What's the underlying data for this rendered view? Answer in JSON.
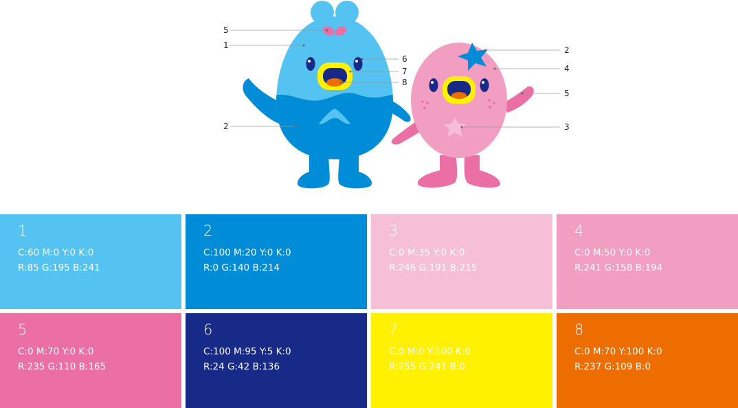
{
  "callouts": {
    "blue": [
      "5",
      "1",
      "2"
    ],
    "center": [
      "6",
      "7",
      "8"
    ],
    "pink": [
      "2",
      "4",
      "5",
      "3"
    ]
  },
  "swatches": [
    {
      "number": "1",
      "cmyk": "C:60 M:0 Y:0 K:0",
      "rgb": "R:85 G:195 B:241",
      "color": "#55c3f1"
    },
    {
      "number": "2",
      "cmyk": "C:100 M:20 Y:0 K:0",
      "rgb": "R:0 G:140 B:214",
      "color": "#008cd6"
    },
    {
      "number": "3",
      "cmyk": "C:0 M:35 Y:0 K:0",
      "rgb": "R:246 G:191 B:215",
      "color": "#f6bfd7"
    },
    {
      "number": "4",
      "cmyk": "C:0 M:50 Y:0 K:0",
      "rgb": "R:241 G:158 B:194",
      "color": "#f19ec2"
    },
    {
      "number": "5",
      "cmyk": "C:0 M:70 Y:0 K:0",
      "rgb": "R:235 G:110 B:165",
      "color": "#eb6ea5"
    },
    {
      "number": "6",
      "cmyk": "C:100 M:95 Y:5 K:0",
      "rgb": "R:24 G:42 B:136",
      "color": "#182a88"
    },
    {
      "number": "7",
      "cmyk": "C:0 M:0 Y:100 K:0",
      "rgb": "R:255 G:241 B:0",
      "color": "#fff100"
    },
    {
      "number": "8",
      "cmyk": "C:0 M:70 Y:100 K:0",
      "rgb": "R:237 G:109 B:0",
      "color": "#ed6d00"
    }
  ]
}
